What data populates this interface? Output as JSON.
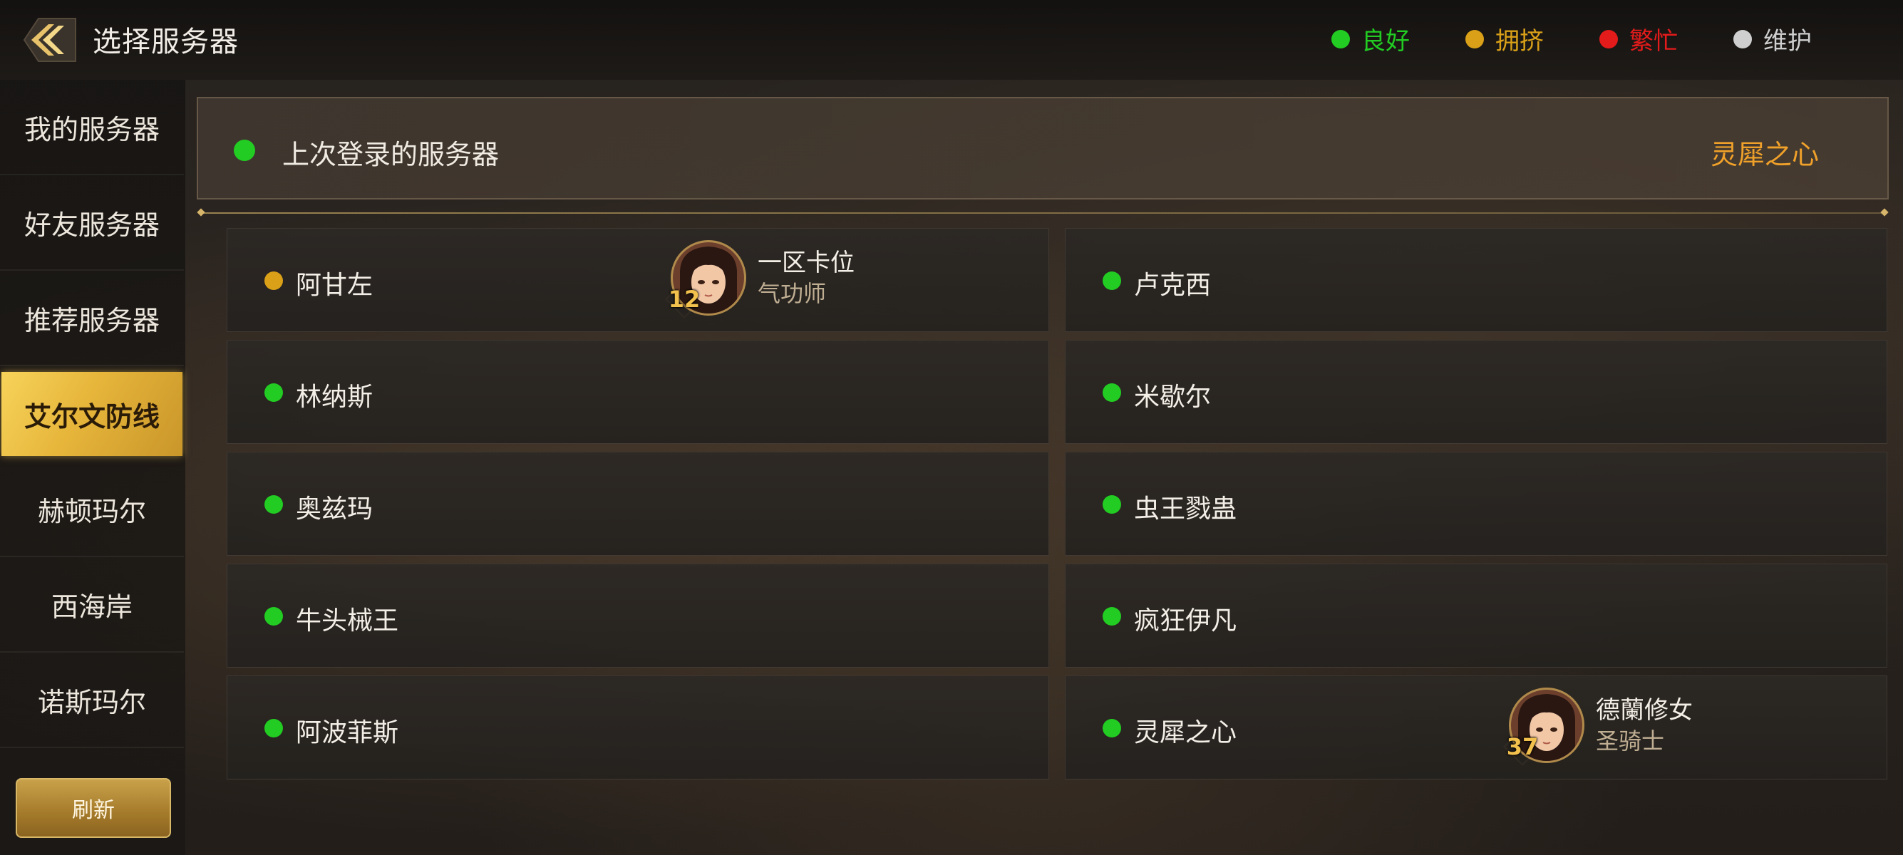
{
  "header": {
    "title": "选择服务器",
    "legend": [
      {
        "label": "良好",
        "color": "#22cc22"
      },
      {
        "label": "拥挤",
        "color": "#d9a018"
      },
      {
        "label": "繁忙",
        "color": "#e31b1b"
      },
      {
        "label": "维护",
        "color": "#cfcfcf"
      }
    ]
  },
  "sidebar": {
    "items": [
      {
        "label": "我的服务器"
      },
      {
        "label": "好友服务器"
      },
      {
        "label": "推荐服务器"
      },
      {
        "label": "艾尔文防线",
        "active": true
      },
      {
        "label": "赫顿玛尔"
      },
      {
        "label": "西海岸"
      },
      {
        "label": "诺斯玛尔"
      }
    ],
    "refresh_label": "刷新"
  },
  "last_login": {
    "label": "上次登录的服务器",
    "server": "灵犀之心",
    "status_color": "#22cc22"
  },
  "servers": [
    {
      "name": "阿甘左",
      "status_color": "#d9a018",
      "character": {
        "name": "一区卡位",
        "class": "气功师",
        "level": "12"
      }
    },
    {
      "name": "卢克西",
      "status_color": "#22cc22"
    },
    {
      "name": "林纳斯",
      "status_color": "#22cc22"
    },
    {
      "name": "米歇尔",
      "status_color": "#22cc22"
    },
    {
      "name": "奥兹玛",
      "status_color": "#22cc22"
    },
    {
      "name": "虫王戮蛊",
      "status_color": "#22cc22"
    },
    {
      "name": "牛头械王",
      "status_color": "#22cc22"
    },
    {
      "name": "疯狂伊凡",
      "status_color": "#22cc22"
    },
    {
      "name": "阿波菲斯",
      "status_color": "#22cc22"
    },
    {
      "name": "灵犀之心",
      "status_color": "#22cc22",
      "character": {
        "name": "德蘭修女",
        "class": "圣骑士",
        "level": "37"
      }
    }
  ]
}
